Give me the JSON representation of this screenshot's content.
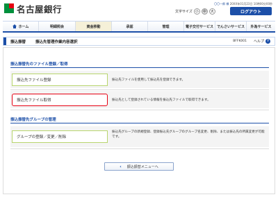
{
  "header": {
    "bank_name": "名古屋銀行",
    "user_name": "〇〇一郎 様",
    "last_login": "20XX年01月23日 10時00分00秒",
    "font_size_label": "文字サイズ",
    "font_sizes": [
      "小",
      "中",
      "大"
    ],
    "logout_label": "ログアウト"
  },
  "nav": {
    "items": [
      "ホーム",
      "明細照会",
      "資金移動",
      "承認",
      "管理",
      "電子交付サービス",
      "でんさいサービス",
      "外為サービス"
    ]
  },
  "titlebar": {
    "category": "振込振替",
    "title": "振込先管理作業内容選択",
    "code": "BFFK001",
    "help_label": "ヘルプ",
    "help_icon": "?"
  },
  "sections": [
    {
      "heading": "振込振替先のファイル登録／取得",
      "rows": [
        {
          "button": "振込先ファイル登録",
          "desc": "振込先ファイルを使用して振込先を登録できます。"
        },
        {
          "button": "振込先ファイル取得",
          "desc": "振込先として登録されている情報を振込先ファイルで取得できます。"
        }
      ]
    },
    {
      "heading": "振込振替先グループの管理",
      "rows": [
        {
          "button": "グループの登録／変更／削除",
          "desc": "振込先グループの新規登録、登録振込先グループのグループ名変更、削除、または振込先の所属変更が可能です。"
        }
      ]
    }
  ],
  "back_button": {
    "label": "振込振替メニューへ",
    "icon": "chevron-left"
  },
  "colors": {
    "brand": "#1c4fa8",
    "logo_green": "#00903c",
    "logo_red": "#e60012",
    "selected_border": "#e60012",
    "button_border": "#b8d56d"
  }
}
